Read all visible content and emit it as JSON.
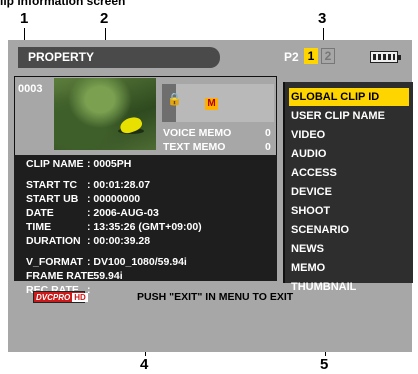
{
  "caption": "lip information screen",
  "callouts": [
    "1",
    "2",
    "3",
    "4",
    "5"
  ],
  "header": {
    "title": "PROPERTY",
    "p2_label": "P2",
    "slot1": "1",
    "slot2": "2"
  },
  "clip_number": "0003",
  "memo": {
    "voice_label": "VOICE MEMO",
    "voice_count": "0",
    "text_label": "TEXT MEMO",
    "text_count": "0",
    "mark": "M"
  },
  "properties": [
    {
      "label": "CLIP NAME",
      "value": ": 0005PH"
    },
    {
      "label": "START TC",
      "value": ": 00:01:28.07"
    },
    {
      "label": "START UB",
      "value": ": 00000000"
    },
    {
      "label": "DATE",
      "value": ": 2006-AUG-03"
    },
    {
      "label": "TIME",
      "value": ": 13:35:26 (GMT+09:00)"
    },
    {
      "label": "DURATION",
      "value": ": 00:00:39.28"
    },
    {
      "label": "V_FORMAT",
      "value": ": DV100_1080/59.94i"
    },
    {
      "label": "FRAME RATE",
      "value": ": 59.94i"
    },
    {
      "label": "REC RATE",
      "value": ":"
    }
  ],
  "menu": {
    "items": [
      "GLOBAL CLIP ID",
      "USER CLIP NAME",
      "VIDEO",
      "AUDIO",
      "ACCESS",
      "DEVICE",
      "SHOOT",
      "SCENARIO",
      "NEWS",
      "MEMO",
      "THUMBNAIL"
    ],
    "selected_index": 0
  },
  "footer": {
    "logo_text": "DVCPRO",
    "logo_badge": "HD",
    "instruction": "PUSH \"EXIT\" IN MENU TO EXIT"
  },
  "colors": {
    "accent": "#ffd500",
    "screen_bg": "#a7a7a7",
    "panel_bg": "#1e1e1e"
  }
}
